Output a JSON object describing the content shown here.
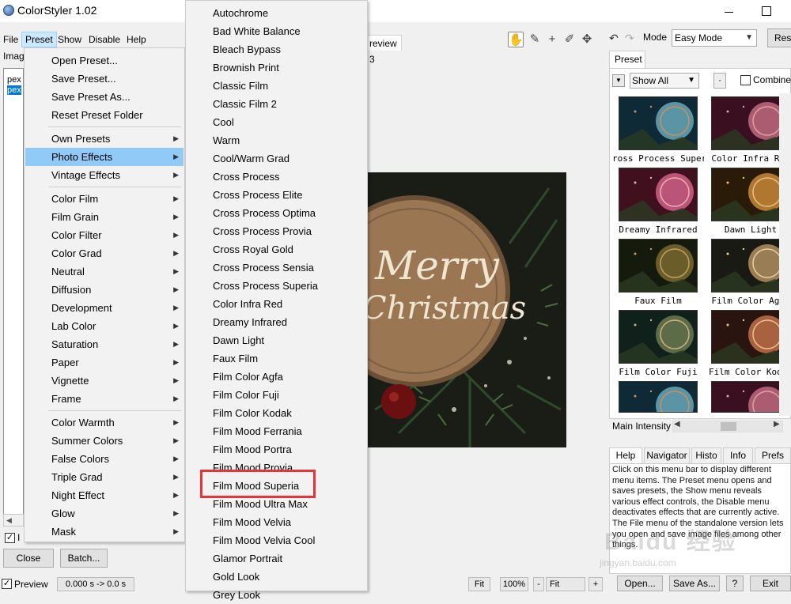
{
  "window": {
    "title": "ColorStyler 1.02"
  },
  "menubar": [
    "File",
    "Preset",
    "Show",
    "Disable",
    "Help"
  ],
  "left_panel": {
    "tab": "Imag",
    "items": [
      "pex",
      "pex"
    ],
    "checkbox_label": "I",
    "close_button": "Close",
    "batch_button": "Batch..."
  },
  "status": {
    "preview_label": "Preview",
    "time": "0.000 s -> 0.0 s"
  },
  "preview_tab": "review 3",
  "image_text": {
    "line1": "Merry",
    "line2": "Christmas"
  },
  "preset_menu": {
    "items": [
      {
        "label": "Open Preset...",
        "arrow": false
      },
      {
        "label": "Save Preset...",
        "arrow": false
      },
      {
        "label": "Save Preset As...",
        "arrow": false
      },
      {
        "label": "Reset Preset Folder",
        "arrow": false
      },
      {
        "label": "Own Presets",
        "arrow": true
      },
      {
        "label": "Photo Effects",
        "arrow": true,
        "highlighted": true
      },
      {
        "label": "Vintage Effects",
        "arrow": true
      },
      {
        "label": "Color Film",
        "arrow": true
      },
      {
        "label": "Film Grain",
        "arrow": true
      },
      {
        "label": "Color Filter",
        "arrow": true
      },
      {
        "label": "Color Grad",
        "arrow": true
      },
      {
        "label": "Neutral",
        "arrow": true
      },
      {
        "label": "Diffusion",
        "arrow": true
      },
      {
        "label": "Development",
        "arrow": true
      },
      {
        "label": "Lab Color",
        "arrow": true
      },
      {
        "label": "Saturation",
        "arrow": true
      },
      {
        "label": "Paper",
        "arrow": true
      },
      {
        "label": "Vignette",
        "arrow": true
      },
      {
        "label": "Frame",
        "arrow": true
      },
      {
        "label": "Color Warmth",
        "arrow": true
      },
      {
        "label": "Summer Colors",
        "arrow": true
      },
      {
        "label": "False Colors",
        "arrow": true
      },
      {
        "label": "Triple Grad",
        "arrow": true
      },
      {
        "label": "Night Effect",
        "arrow": true
      },
      {
        "label": "Glow",
        "arrow": true
      },
      {
        "label": "Mask",
        "arrow": true
      }
    ]
  },
  "photo_effects_submenu": [
    "Autochrome",
    "Bad White Balance",
    "Bleach Bypass",
    "Brownish Print",
    "Classic Film",
    "Classic Film 2",
    "Cool",
    "Warm",
    "Cool/Warm Grad",
    "Cross Process",
    "Cross Process Elite",
    "Cross Process Optima",
    "Cross Process Provia",
    "Cross Royal Gold",
    "Cross Process Sensia",
    "Cross Process Superia",
    "Color Infra Red",
    "Dreamy Infrared",
    "Dawn Light",
    "Faux Film",
    "Film Color Agfa",
    "Film Color Fuji",
    "Film Color Kodak",
    "Film Mood Ferrania",
    "Film Mood Portra",
    "Film Mood Provia",
    "Film Mood Superia",
    "Film Mood Ultra Max",
    "Film Mood Velvia",
    "Film Mood Velvia Cool",
    "Glamor Portrait",
    "Gold Look",
    "Grey Look"
  ],
  "highlighted_item": "Film Mood Superia",
  "right_panel": {
    "mode_label": "Mode",
    "mode_value": "Easy Mode",
    "reset_label": "Res",
    "preset_tab": "Preset",
    "show_all": "Show All",
    "dot_button": "·",
    "combine_label": "Combine",
    "thumbnails": [
      "ross Process Superia",
      "Color Infra Red",
      "Dreamy Infrared",
      "Dawn Light",
      "Faux Film",
      "Film Color Agfa",
      "Film Color Fuji",
      "Film Color Kodak"
    ],
    "intensity_label": "Main Intensity",
    "help_tabs": [
      "Help",
      "Navigator",
      "Histo",
      "Info",
      "Prefs"
    ],
    "help_text": "Click on this menu bar to display different menu items. The Preset menu opens and saves presets, the Show menu reveals various effect controls, the Disable menu deactivates effects that are currently active. The File menu of the standalone version lets you open and save image files among other things.",
    "buttons": [
      "Open...",
      "Save As...",
      "?",
      "Exit"
    ]
  },
  "bottom_controls": {
    "fit1": "Fit",
    "zoom": "100%",
    "minus": "-",
    "fit2": "Fit",
    "plus": "+"
  },
  "watermark": {
    "logo": "Baidu 经验",
    "url": "jingyan.baidu.com"
  },
  "colors": {
    "menu_highlight": "#91c9f7",
    "red_box": "#e8333b",
    "selection": "#0078d7"
  }
}
